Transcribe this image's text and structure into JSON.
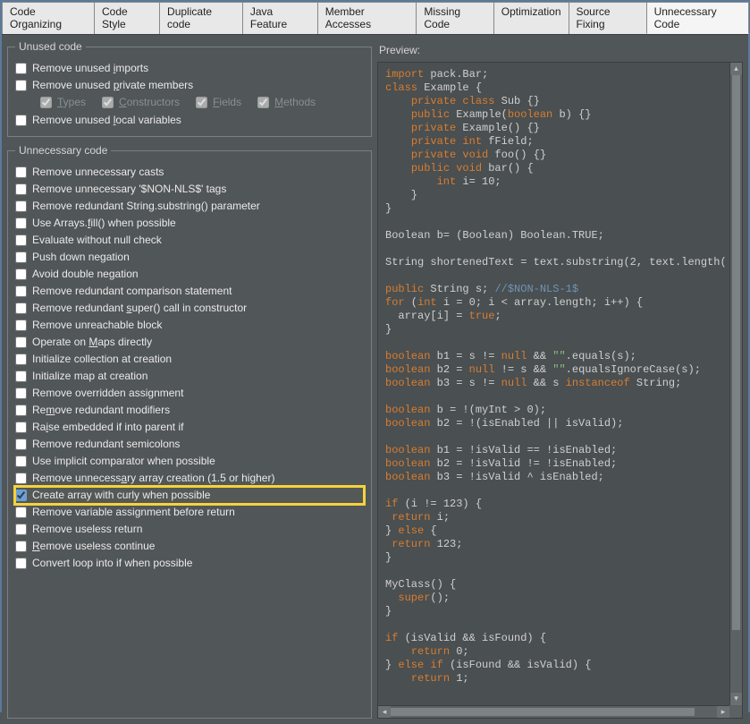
{
  "tabs": {
    "items": [
      "Code Organizing",
      "Code Style",
      "Duplicate code",
      "Java Feature",
      "Member Accesses",
      "Missing Code",
      "Optimization",
      "Source Fixing",
      "Unnecessary Code"
    ],
    "active_index": 8
  },
  "unused": {
    "legend": "Unused code",
    "items": [
      {
        "label": "Remove unused imports",
        "u": "i",
        "checked": false
      },
      {
        "label": "Remove unused private members",
        "u": "p",
        "checked": false
      },
      {
        "label": "Remove unused local variables",
        "u": "l",
        "checked": false
      }
    ],
    "sub": [
      {
        "label": "Types",
        "u": "T",
        "checked": true,
        "disabled": true
      },
      {
        "label": "Constructors",
        "u": "C",
        "checked": true,
        "disabled": true
      },
      {
        "label": "Fields",
        "u": "F",
        "checked": true,
        "disabled": true
      },
      {
        "label": "Methods",
        "u": "M",
        "checked": true,
        "disabled": true
      }
    ]
  },
  "unnecessary": {
    "legend": "Unnecessary code",
    "items": [
      {
        "label": "Remove unnecessary casts",
        "checked": false
      },
      {
        "label": "Remove unnecessary '$NON-NLS$' tags",
        "checked": false
      },
      {
        "label": "Remove redundant String.substring() parameter",
        "checked": false
      },
      {
        "label": "Use Arrays.fill() when possible",
        "u": "f",
        "checked": false
      },
      {
        "label": "Evaluate without null check",
        "checked": false
      },
      {
        "label": "Push down negation",
        "checked": false
      },
      {
        "label": "Avoid double negation",
        "checked": false
      },
      {
        "label": "Remove redundant comparison statement",
        "checked": false
      },
      {
        "label": "Remove redundant super() call in constructor",
        "u": "s",
        "checked": false
      },
      {
        "label": "Remove unreachable block",
        "checked": false
      },
      {
        "label": "Operate on Maps directly",
        "u": "M",
        "checked": false
      },
      {
        "label": "Initialize collection at creation",
        "checked": false
      },
      {
        "label": "Initialize map at creation",
        "checked": false
      },
      {
        "label": "Remove overridden assignment",
        "checked": false
      },
      {
        "label": "Remove redundant modifiers",
        "u": "m",
        "checked": false
      },
      {
        "label": "Raise embedded if into parent if",
        "u": "i",
        "checked": false
      },
      {
        "label": "Remove redundant semicolons",
        "checked": false
      },
      {
        "label": "Use implicit comparator when possible",
        "checked": false
      },
      {
        "label": "Remove unnecessary array creation (1.5 or higher)",
        "u": "a",
        "checked": false
      },
      {
        "label": "Create array with curly when possible",
        "checked": true,
        "highlight": true
      },
      {
        "label": "Remove variable assignment before return",
        "checked": false
      },
      {
        "label": "Remove useless return",
        "checked": false
      },
      {
        "label": "Remove useless continue",
        "u": "R",
        "checked": false
      },
      {
        "label": "Convert loop into if when possible",
        "checked": false
      }
    ]
  },
  "preview": {
    "label": "Preview:",
    "code_tokens": [
      [
        [
          "kw",
          "import"
        ],
        [
          "",
          " pack.Bar;"
        ]
      ],
      [
        [
          "kw",
          "class"
        ],
        [
          "",
          " Example {"
        ]
      ],
      [
        [
          "",
          "    "
        ],
        [
          "kw",
          "private class"
        ],
        [
          "",
          " Sub {}"
        ]
      ],
      [
        [
          "",
          "    "
        ],
        [
          "kw",
          "public"
        ],
        [
          "",
          " Example("
        ],
        [
          "kw",
          "boolean"
        ],
        [
          "",
          " b) {}"
        ]
      ],
      [
        [
          "",
          "    "
        ],
        [
          "kw",
          "private"
        ],
        [
          "",
          " Example() {}"
        ]
      ],
      [
        [
          "",
          "    "
        ],
        [
          "kw",
          "private int"
        ],
        [
          "",
          " fField;"
        ]
      ],
      [
        [
          "",
          "    "
        ],
        [
          "kw",
          "private void"
        ],
        [
          "",
          " foo() {}"
        ]
      ],
      [
        [
          "",
          "    "
        ],
        [
          "kw",
          "public void"
        ],
        [
          "",
          " bar() {"
        ]
      ],
      [
        [
          "",
          "        "
        ],
        [
          "kw",
          "int"
        ],
        [
          "",
          " i= 10;"
        ]
      ],
      [
        [
          "",
          "    }"
        ]
      ],
      [
        [
          "",
          "}"
        ]
      ],
      [
        [
          "",
          ""
        ]
      ],
      [
        [
          "",
          "Boolean b= (Boolean) Boolean.TRUE;"
        ]
      ],
      [
        [
          "",
          ""
        ]
      ],
      [
        [
          "",
          "String shortenedText = text.substring(2, text.length("
        ]
      ],
      [
        [
          "",
          ""
        ]
      ],
      [
        [
          "kw",
          "public"
        ],
        [
          "",
          " String s; "
        ],
        [
          "cmt",
          "//$NON-NLS-1$"
        ]
      ],
      [
        [
          "kw",
          "for"
        ],
        [
          "",
          " ("
        ],
        [
          "kw",
          "int"
        ],
        [
          "",
          " i = 0; i < array.length; i++) {"
        ]
      ],
      [
        [
          "",
          "  array[i] = "
        ],
        [
          "kw",
          "true"
        ],
        [
          "",
          ";"
        ]
      ],
      [
        [
          "",
          "}"
        ]
      ],
      [
        [
          "",
          ""
        ]
      ],
      [
        [
          "kw",
          "boolean"
        ],
        [
          "",
          " b1 = s != "
        ],
        [
          "kw",
          "null"
        ],
        [
          "",
          " && "
        ],
        [
          "str",
          "\"\""
        ],
        [
          "",
          ".equals(s);"
        ]
      ],
      [
        [
          "kw",
          "boolean"
        ],
        [
          "",
          " b2 = "
        ],
        [
          "kw",
          "null"
        ],
        [
          "",
          " != s && "
        ],
        [
          "str",
          "\"\""
        ],
        [
          "",
          ".equalsIgnoreCase(s);"
        ]
      ],
      [
        [
          "kw",
          "boolean"
        ],
        [
          "",
          " b3 = s != "
        ],
        [
          "kw",
          "null"
        ],
        [
          "",
          " && s "
        ],
        [
          "kw",
          "instanceof"
        ],
        [
          "",
          " String;"
        ]
      ],
      [
        [
          "",
          ""
        ]
      ],
      [
        [
          "kw",
          "boolean"
        ],
        [
          "",
          " b = !(myInt > 0);"
        ]
      ],
      [
        [
          "kw",
          "boolean"
        ],
        [
          "",
          " b2 = !(isEnabled || isValid);"
        ]
      ],
      [
        [
          "",
          ""
        ]
      ],
      [
        [
          "kw",
          "boolean"
        ],
        [
          "",
          " b1 = !isValid == !isEnabled;"
        ]
      ],
      [
        [
          "kw",
          "boolean"
        ],
        [
          "",
          " b2 = !isValid != !isEnabled;"
        ]
      ],
      [
        [
          "kw",
          "boolean"
        ],
        [
          "",
          " b3 = !isValid ^ isEnabled;"
        ]
      ],
      [
        [
          "",
          ""
        ]
      ],
      [
        [
          "kw",
          "if"
        ],
        [
          "",
          " (i != 123) {"
        ]
      ],
      [
        [
          "",
          ""
        ],
        [
          "kw",
          " return"
        ],
        [
          "",
          " i;"
        ]
      ],
      [
        [
          "",
          "} "
        ],
        [
          "kw",
          "else"
        ],
        [
          "",
          " {"
        ]
      ],
      [
        [
          "",
          ""
        ],
        [
          "kw",
          " return"
        ],
        [
          "",
          " 123;"
        ]
      ],
      [
        [
          "",
          "}"
        ]
      ],
      [
        [
          "",
          ""
        ]
      ],
      [
        [
          "",
          "MyClass() {"
        ]
      ],
      [
        [
          "",
          "  "
        ],
        [
          "kw",
          "super"
        ],
        [
          "",
          "();"
        ]
      ],
      [
        [
          "",
          "}"
        ]
      ],
      [
        [
          "",
          ""
        ]
      ],
      [
        [
          "kw",
          "if"
        ],
        [
          "",
          " (isValid && isFound) {"
        ]
      ],
      [
        [
          "",
          "    "
        ],
        [
          "kw",
          "return"
        ],
        [
          "",
          " 0;"
        ]
      ],
      [
        [
          "",
          "} "
        ],
        [
          "kw",
          "else if"
        ],
        [
          "",
          " (isFound && isValid) {"
        ]
      ],
      [
        [
          "",
          "    "
        ],
        [
          "kw",
          "return"
        ],
        [
          "",
          " 1;"
        ]
      ]
    ]
  }
}
